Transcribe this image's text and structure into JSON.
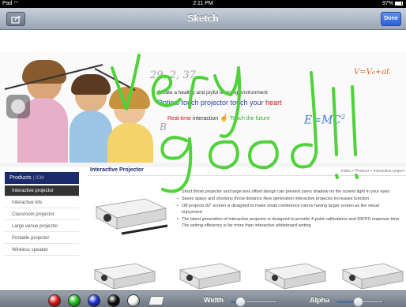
{
  "status_bar": {
    "carrier": "Pad",
    "time": "2:11 PM",
    "battery": "97%"
  },
  "nav_bar": {
    "title": "Sketch",
    "done_label": "Done"
  },
  "banner": {
    "tagline": "Create a healthy and joyful  learning environment",
    "headline_main": "Optical touch projector touch your",
    "headline_heart": "heart",
    "line3_red": "Real-time",
    "line3_mid": "interaction",
    "line3_green": "Touch the future",
    "math_1": "29, 2, 37",
    "math_2": "E=MC",
    "math_2_sup": "2",
    "math_3": "V=V₀+at",
    "letter_b": "B"
  },
  "sidebar": {
    "header_title": "Products",
    "header_sub": "| ICM",
    "items": [
      {
        "label": "Interactive projector",
        "active": true
      },
      {
        "label": "Interactive kits",
        "active": false
      },
      {
        "label": "Classroom projector",
        "active": false
      },
      {
        "label": "Large venue projector",
        "active": false
      },
      {
        "label": "Portable projector",
        "active": false
      },
      {
        "label": "Wireless speaker",
        "active": false
      }
    ]
  },
  "content": {
    "title": "Interactive Projector",
    "breadcrumb": "Index > Product > Interactive project",
    "bullets": [
      "Short throw projector and large lens offset design can prevent users shadow on the screen light in your eyes",
      "Saves space and shortens throw distance New generation interactive projector increases function",
      "1M projects 82\" screen is designed to make small conference rooms having larger screen as the visual enjoyment.",
      "The latest generation of interactive projector is designed to provide 4-point calibrations and 60FPS response time. The writing efficiency is far more than interactive whiteboard writing"
    ]
  },
  "drawing": {
    "ink_color": "#4fd23a",
    "written_text": [
      "Very",
      "good !!"
    ]
  },
  "toolbar": {
    "colors": [
      {
        "name": "red",
        "hex": "#e01818"
      },
      {
        "name": "green",
        "hex": "#1cc21c"
      },
      {
        "name": "blue",
        "hex": "#1a32d8"
      },
      {
        "name": "black",
        "hex": "#111111"
      },
      {
        "name": "white",
        "hex": "#f4f4f4"
      }
    ],
    "width_label": "Width",
    "width_value": 0.2,
    "alpha_label": "Alpha",
    "alpha_value": 0.45
  }
}
